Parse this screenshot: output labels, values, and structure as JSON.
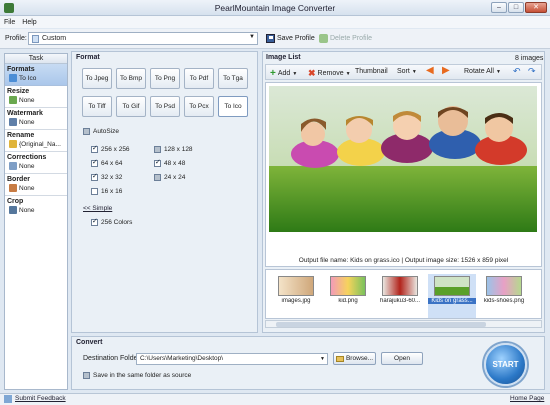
{
  "window": {
    "title": "PearlMountain Image Converter",
    "minimize": "–",
    "maximize": "□",
    "close": "✕"
  },
  "menu": [
    "File",
    "Help"
  ],
  "profile": {
    "label": "Profile:",
    "value": "Custom",
    "save": "Save Profile",
    "delete": "Delete Profile"
  },
  "task": {
    "header": "Task",
    "items": [
      {
        "label": "Formats",
        "value": "To Ico"
      },
      {
        "label": "Resize",
        "value": "None"
      },
      {
        "label": "Watermark",
        "value": "None"
      },
      {
        "label": "Rename",
        "value": "{Original_Na..."
      },
      {
        "label": "Corrections",
        "value": "None"
      },
      {
        "label": "Border",
        "value": "None"
      },
      {
        "label": "Crop",
        "value": "None"
      }
    ]
  },
  "format": {
    "title": "Format",
    "buttons": [
      "To Jpeg",
      "To Bmp",
      "To Png",
      "To Pdf",
      "To Tga",
      "To Tiff",
      "To Gif",
      "To Psd",
      "To Pcx",
      "To Ico"
    ],
    "autosize": "AutoSize",
    "sizes": [
      {
        "label": "256 x 256",
        "checked": true
      },
      {
        "label": "128 x 128",
        "checked": false
      },
      {
        "label": "64 x 64",
        "checked": true
      },
      {
        "label": "48 x 48",
        "checked": true
      },
      {
        "label": "32 x 32",
        "checked": true
      },
      {
        "label": "24 x 24",
        "checked": false
      },
      {
        "label": "16 x 16",
        "checked": false
      }
    ],
    "simple_link": "<< Simple",
    "colors": "256 Colors"
  },
  "imagelist": {
    "title": "Image List",
    "count": "8 images",
    "toolbar": {
      "add": "Add",
      "remove": "Remove",
      "thumbnail": "Thumbnail",
      "sort": "Sort",
      "rotate_all": "Rotate All"
    },
    "caption": "Output file name: Kids on grass.ico | Output image size: 1526 x 859 pixel",
    "thumbs": [
      "images.jpg",
      "kid.png",
      "harajuku3-60...",
      "Kids on grass...",
      "kids-shoes.png"
    ]
  },
  "convert": {
    "title": "Convert",
    "dest_label": "Destination Folder:",
    "dest_value": "C:\\Users\\Marketing\\Desktop\\",
    "browse": "Browse...",
    "open": "Open",
    "same_folder": "Save in the same folder as source",
    "start": "START"
  },
  "status": {
    "feedback": "Submit Feedback",
    "home": "Home Page"
  }
}
